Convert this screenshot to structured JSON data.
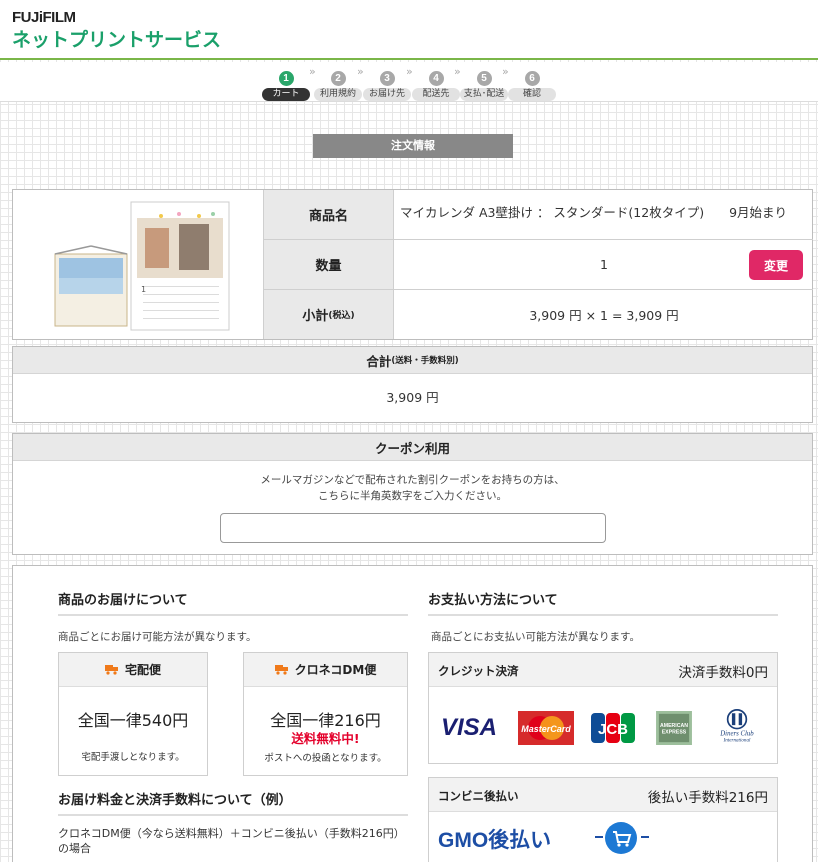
{
  "header": {
    "brand": "FUJiFILM",
    "service_name": "ネットプリントサービス"
  },
  "steps": [
    {
      "num": "1",
      "label": "カート",
      "active": true
    },
    {
      "num": "2",
      "label": "利用規約",
      "active": false
    },
    {
      "num": "3",
      "label": "お届け先",
      "active": false
    },
    {
      "num": "4",
      "label": "配送先",
      "active": false
    },
    {
      "num": "5",
      "label": "支払･配送",
      "active": false
    },
    {
      "num": "6",
      "label": "確認",
      "active": false
    }
  ],
  "order_title": "注文情報",
  "product": {
    "name_label": "商品名",
    "name_value": "マイカレンダ A3壁掛け ： スタンダード(12枚タイプ)　　9月始まり",
    "qty_label": "数量",
    "qty_value": "1",
    "change_label": "変更",
    "subtotal_label": "小計",
    "subtotal_suffix": "(税込)",
    "subtotal_value": "3,909 円 × 1 = 3,909 円"
  },
  "total": {
    "label": "合計",
    "suffix": "(送料・手数料別)",
    "value": "3,909 円"
  },
  "coupon": {
    "title": "クーポン利用",
    "line1": "メールマガジンなどで配布された割引クーポンをお持ちの方は、",
    "line2": "こちらに半角英数字をご入力ください。",
    "input_value": ""
  },
  "delivery": {
    "title": "商品のお届けについて",
    "note": "商品ごとにお届け可能方法が異なります。",
    "options": [
      {
        "name": "宅配便",
        "price": "全国一律540円",
        "free": "",
        "note": "宅配手渡しとなります。"
      },
      {
        "name": "クロネコDM便",
        "price": "全国一律216円",
        "free": "送料無料中!",
        "note": "ポストへの投函となります。"
      }
    ],
    "example_title": "お届け料金と決済手数料について（例）",
    "example_line1": "クロネコDM便（今なら送料無料）＋コンビニ後払い（手数料216円）",
    "example_line2": "の場合"
  },
  "payment": {
    "title": "お支払い方法について",
    "note": "商品ごとにお支払い可能方法が異なります。",
    "methods": [
      {
        "name": "クレジット決済",
        "fee": "決済手数料0円"
      },
      {
        "name": "コンビニ後払い",
        "fee": "後払い手数料216円"
      }
    ],
    "card_brands": [
      "VISA",
      "MasterCard",
      "JCB",
      "AMERICAN EXPRESS",
      "Diners Club International"
    ],
    "gmo_text": "GMO後払い"
  },
  "colors": {
    "brand_green": "#1aa06a",
    "step_active": "#2aa66a",
    "change_button": "#e02866",
    "free_red": "#e4002b",
    "truck_orange": "#f07a1a"
  }
}
